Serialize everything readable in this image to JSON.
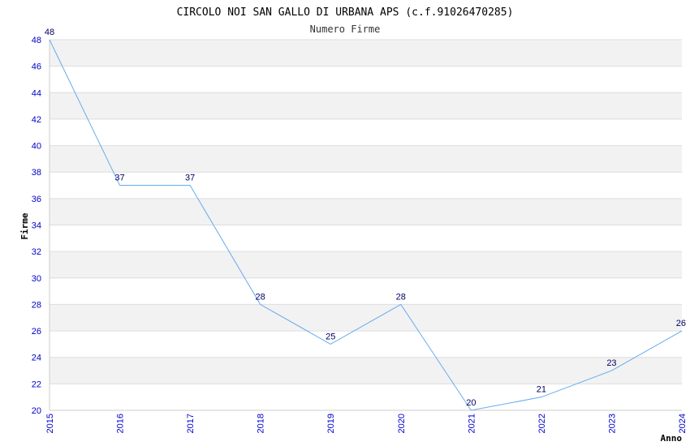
{
  "chart_data": {
    "type": "line",
    "title": "CIRCOLO NOI SAN GALLO DI URBANA APS (c.f.91026470285)",
    "subtitle": "Numero Firme",
    "xlabel": "Anno",
    "ylabel": "Firme",
    "x": [
      "2015",
      "2016",
      "2017",
      "2018",
      "2019",
      "2020",
      "2021",
      "2022",
      "2023",
      "2024"
    ],
    "values": [
      48,
      37,
      37,
      28,
      25,
      28,
      20,
      21,
      23,
      26
    ],
    "ylim": [
      20,
      48
    ],
    "yticks": [
      20,
      22,
      24,
      26,
      28,
      30,
      32,
      34,
      36,
      38,
      40,
      42,
      44,
      46,
      48
    ],
    "grid": true,
    "colors": {
      "line": "#66aaee",
      "band": "#f2f2f2",
      "grid": "#dddddd",
      "tick_text": "#0000cc",
      "data_label": "#000066"
    }
  }
}
